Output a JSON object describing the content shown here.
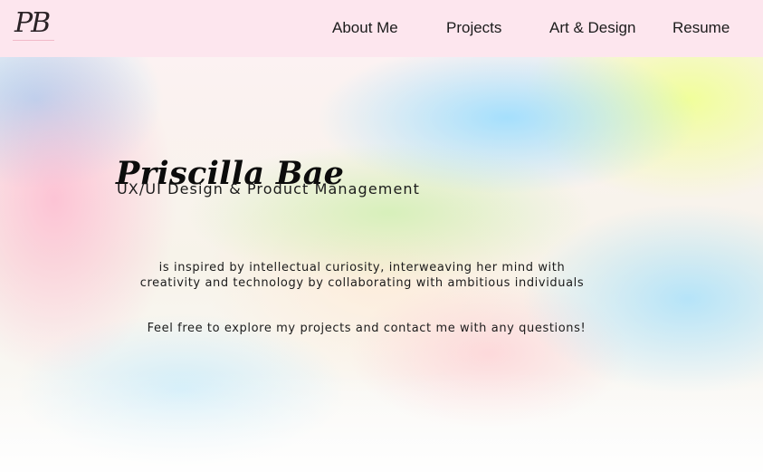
{
  "header": {
    "logo_text": "PB",
    "nav": {
      "about": "About Me",
      "projects": "Projects",
      "art_design": "Art & Design",
      "resume": "Resume"
    },
    "background_color": "#fde6ee"
  },
  "hero": {
    "name": "Priscilla Bae",
    "subtitle": "UX/UI Design & Product Management",
    "bio_line_1": "is inspired by intellectual curiosity, interweaving her mind with",
    "bio_line_2": "creativity and technology by collaborating with ambitious individuals",
    "contact_note": "Feel free to explore my projects and contact me with any questions!"
  }
}
